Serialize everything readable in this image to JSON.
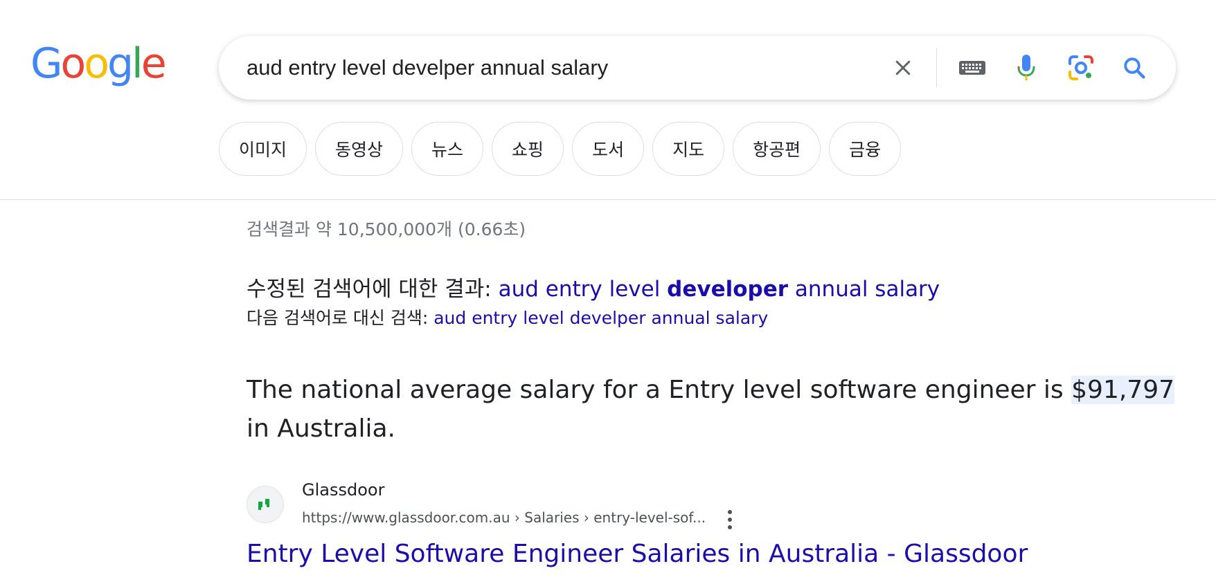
{
  "logo": {
    "letters": [
      "G",
      "o",
      "o",
      "g",
      "l",
      "e"
    ],
    "colors": [
      "#4285f4",
      "#ea4335",
      "#fbbc05",
      "#4285f4",
      "#34a853",
      "#ea4335"
    ]
  },
  "search": {
    "query": "aud entry level develper annual salary",
    "icons": [
      "clear-icon",
      "keyboard-icon",
      "mic-icon",
      "lens-icon",
      "search-icon"
    ]
  },
  "chips": [
    "이미지",
    "동영상",
    "뉴스",
    "쇼핑",
    "도서",
    "지도",
    "항공편",
    "금융"
  ],
  "stats": "검색결과 약 10,500,000개 (0.66초)",
  "spelling": {
    "corrected_prefix": "수정된 검색어에 대한 결과: ",
    "corrected_part1": "aud entry level ",
    "corrected_bold": "developer",
    "corrected_part2": " annual salary",
    "instead_prefix": "다음 검색어로 대신 검색: ",
    "instead_query": "aud entry level develper annual salary"
  },
  "featured_snippet": {
    "text_before": "The national average salary for a Entry level software engineer is ",
    "highlight": "$91,797",
    "text_after": " in Australia."
  },
  "source": {
    "site_name": "Glassdoor",
    "url": "https://www.glassdoor.com.au › Salaries › entry-level-sof...",
    "title": "Entry Level Software Engineer Salaries in Australia - Glassdoor",
    "accent": "#0caa41"
  },
  "colors": {
    "link": "#1a0dab",
    "text": "#202124",
    "muted": "#70757a",
    "highlight": "#e8f0fe"
  }
}
